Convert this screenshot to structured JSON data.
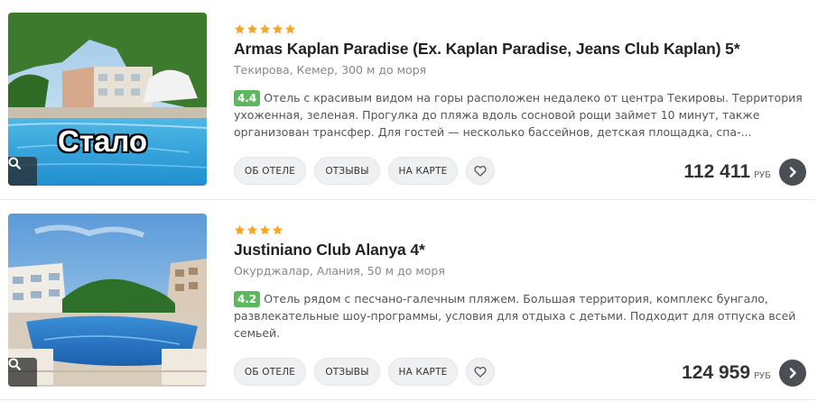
{
  "hotels": [
    {
      "stars": 5,
      "name": "Armas Kaplan Paradise (Ex. Kaplan Paradise, Jeans Club Kaplan) 5*",
      "location": "Текирова, Кемер, 300 м до моря",
      "rating": "4.4",
      "description": "Отель с красивым видом на горы расположен недалеко от центра Текировы. Территория ухоженная, зеленая. Прогулка до пляжа вдоль сосновой рощи займет 10 минут, также организован трансфер. Для гостей — несколько бассейнов, детская площадка, спа-...",
      "photo_overlay_text": "Стало",
      "buttons": {
        "about": "ОБ ОТЕЛЕ",
        "reviews": "ОТЗЫВЫ",
        "map": "НА КАРТЕ"
      },
      "price": "112 411",
      "currency": "РУБ"
    },
    {
      "stars": 4,
      "name": "Justiniano Club Alanya 4*",
      "location": "Окурджалар, Алания, 50 м до моря",
      "rating": "4.2",
      "description": "Отель рядом с песчано-галечным пляжем. Большая территория, комплекс бунгало, развлекательные шоу-программы, условия для отдыха с детьми. Подходит для отпуска всей семьей.",
      "buttons": {
        "about": "ОБ ОТЕЛЕ",
        "reviews": "ОТЗЫВЫ",
        "map": "НА КАРТЕ"
      },
      "price": "124 959",
      "currency": "РУБ"
    }
  ],
  "icons": {
    "star": "star-icon",
    "search": "search-icon",
    "heart": "heart-icon",
    "next": "chevron-right-icon"
  },
  "colors": {
    "star": "#f5a623",
    "rating": "#5cb85c",
    "next_button": "#4a4f55",
    "pill_bg": "#eef0f2"
  }
}
